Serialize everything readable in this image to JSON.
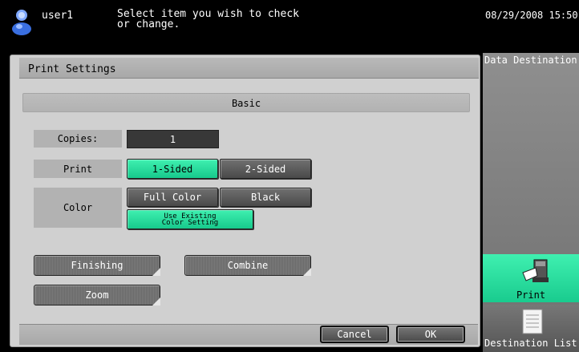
{
  "header": {
    "user": "user1",
    "instruction": "Select item you wish to check\nor change.",
    "datetime": "08/29/2008  15:50"
  },
  "panel": {
    "title": "Print Settings",
    "tab": "Basic",
    "copies_label": "Copies:",
    "copies_value": "1",
    "print_label": "Print",
    "one_sided": "1-Sided",
    "two_sided": "2-Sided",
    "color_label": "Color",
    "full_color": "Full Color",
    "black": "Black",
    "use_existing": "Use Existing\nColor Setting",
    "finishing": "Finishing",
    "combine": "Combine",
    "zoom": "Zoom",
    "cancel": "Cancel",
    "ok": "OK"
  },
  "side": {
    "data_destination": "Data Destination",
    "print": "Print",
    "destination_list": "Destination List"
  },
  "colors": {
    "accent_green": "#22dd9c",
    "button_dark": "#5a5a5a",
    "panel_bg": "#d0d0d0"
  }
}
